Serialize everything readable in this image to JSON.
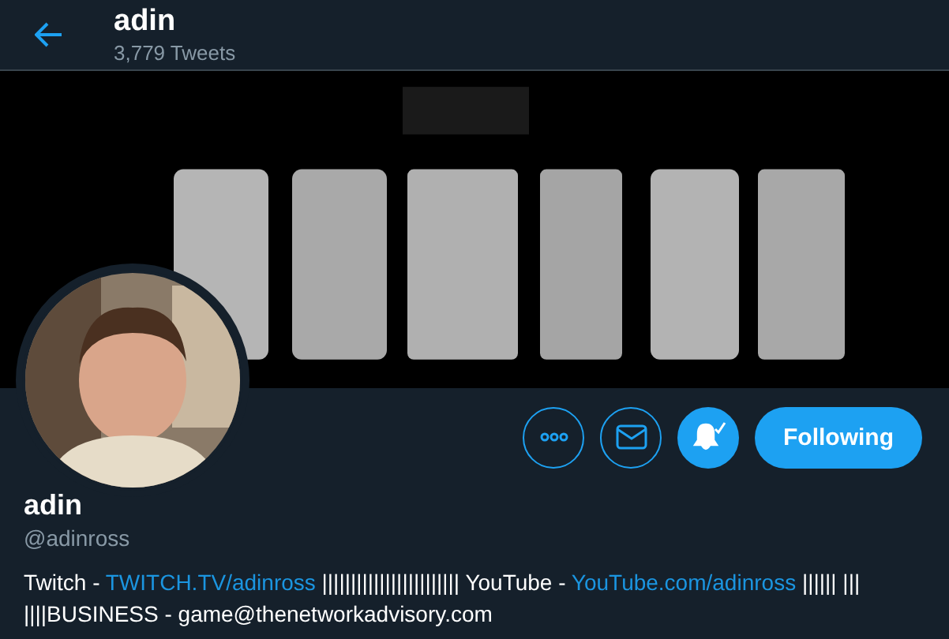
{
  "header": {
    "title": "adin",
    "subtitle": "3,779 Tweets"
  },
  "actions": [
    {
      "kind": "more"
    },
    {
      "kind": "message"
    },
    {
      "kind": "notify",
      "on": true
    },
    {
      "kind": "follow",
      "label": "Following"
    }
  ],
  "profile": {
    "name": "adin",
    "handle": "@adinross"
  },
  "bio": [
    {
      "kind": "text",
      "text": "Twitch - "
    },
    {
      "kind": "link",
      "text": "TWITCH.TV/adinross"
    },
    {
      "kind": "text",
      "text": " |||||||||||||||||||||||| YouTube - "
    },
    {
      "kind": "link",
      "text": "YouTube.com/adinross"
    },
    {
      "kind": "text",
      "text": " |||||| ||| ||||BUSINESS - game@thenetworkadvisory.com"
    }
  ]
}
